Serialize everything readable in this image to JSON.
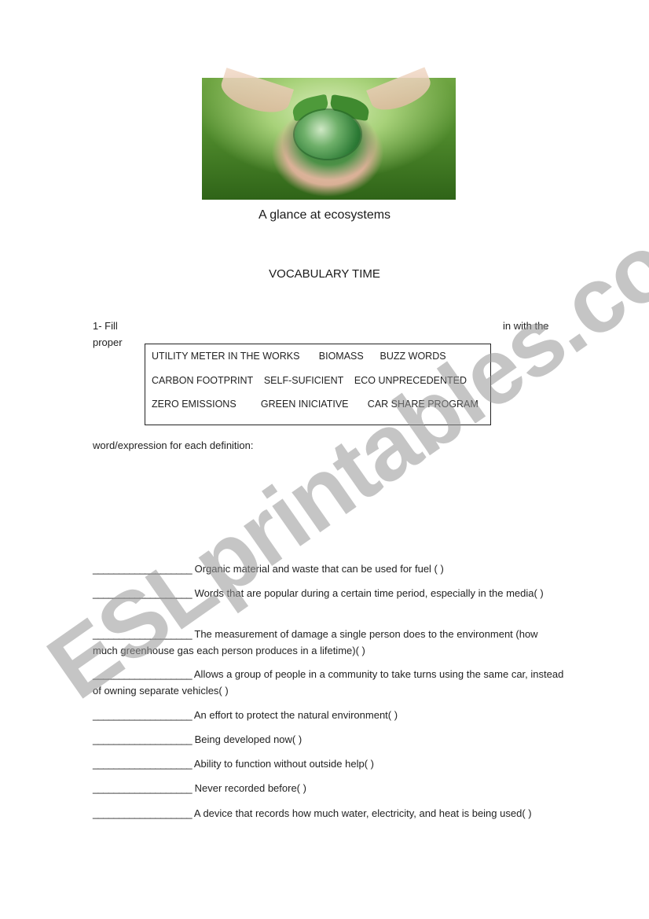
{
  "header": {
    "image_alt": "Hands holding a green globe wrapped in leaves",
    "subtitle": "A glance at ecosystems",
    "section_title": "VOCABULARY TIME"
  },
  "exercise": {
    "instruction_part1": "1-  Fill",
    "instruction_part2": "in with the",
    "instruction_part3": "proper",
    "instruction_part4": "word/expression for each definition:",
    "word_bank_rows": [
      "UTILITY METER IN THE WORKS       BIOMASS      BUZZ WORDS",
      "CARBON FOOTPRINT    SELF-SUFICIENT    ECO UNPRECEDENTED",
      "ZERO EMISSIONS         GREEN INICIATIVE       CAR SHARE PROGRAM"
    ],
    "definitions": [
      {
        "blank": "___________________",
        "text": "Organic material and waste that can be used for fuel  (                )"
      },
      {
        "blank": "___________________",
        "text": "Words that are popular during a certain time period, especially in the media(                )"
      },
      {
        "blank": "___________________",
        "text": "The measurement of damage a single person does to the environment (how much greenhouse gas each person produces in a lifetime)(                )"
      },
      {
        "blank": "___________________",
        "text": "Allows a group of people in a community to take turns using the same car, instead of owning separate vehicles(                )"
      },
      {
        "blank": "___________________",
        "text": "An effort to protect the natural environment(                )"
      },
      {
        "blank": "___________________",
        "text": "Being developed now(                )"
      },
      {
        "blank": "___________________",
        "text": "Ability to function without outside help(                )"
      },
      {
        "blank": "___________________",
        "text": "Never recorded before(                )"
      },
      {
        "blank": "___________________",
        "text": "A device that records how much water, electricity, and heat is being used(                )"
      }
    ]
  },
  "watermark": "ESLprintables.com"
}
